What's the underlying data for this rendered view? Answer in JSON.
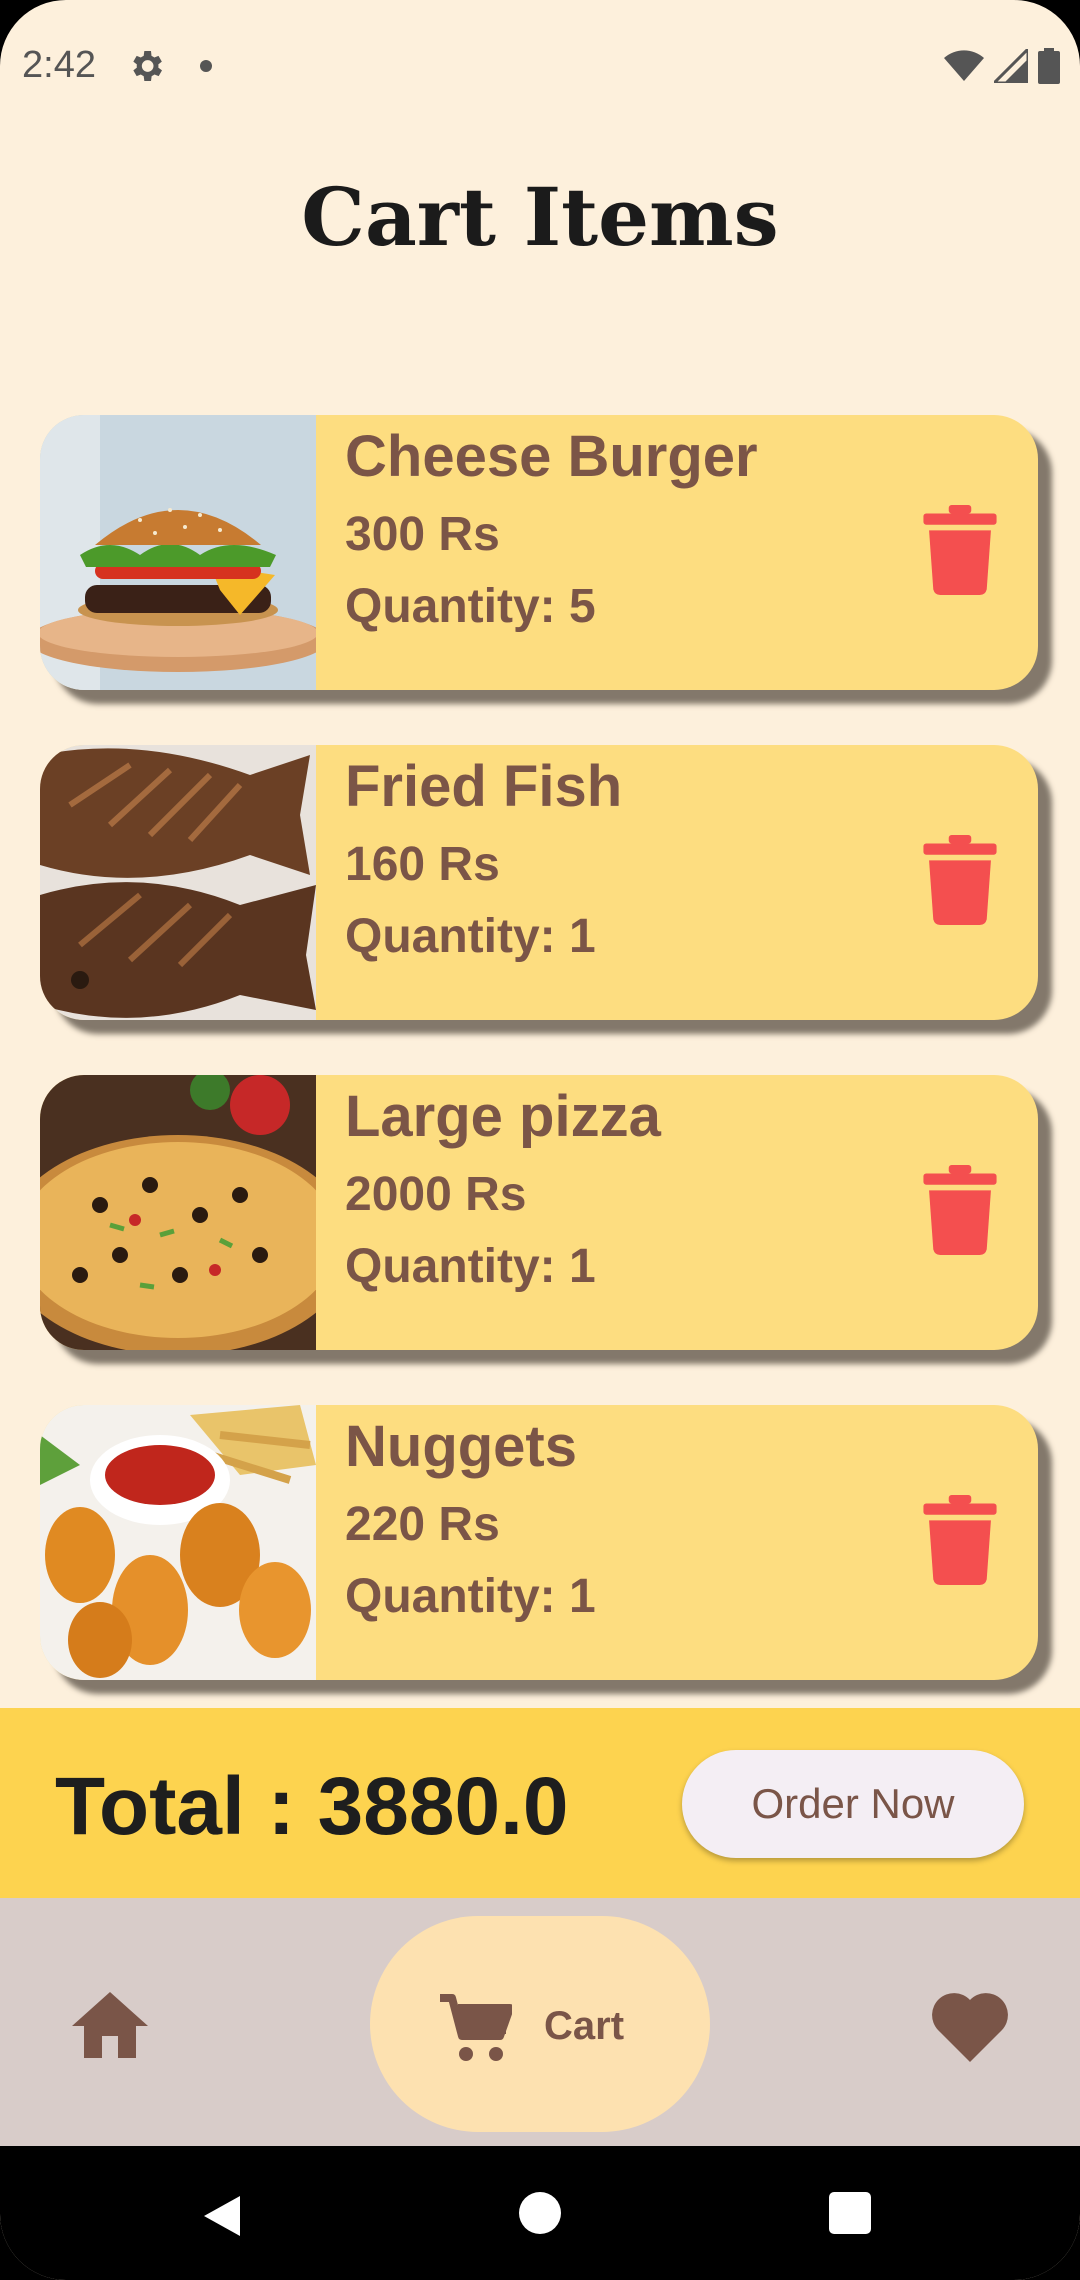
{
  "status_bar": {
    "time": "2:42"
  },
  "page": {
    "title": "Cart Items"
  },
  "cart": {
    "items": [
      {
        "name": "Cheese Burger",
        "price": "300 Rs",
        "quantity": "Quantity: 5",
        "image": "burger"
      },
      {
        "name": "Fried Fish",
        "price": "160 Rs",
        "quantity": "Quantity: 1",
        "image": "fried-fish"
      },
      {
        "name": "Large pizza",
        "price": "2000 Rs",
        "quantity": "Quantity: 1",
        "image": "pizza"
      },
      {
        "name": "Nuggets",
        "price": "220 Rs",
        "quantity": "Quantity: 1",
        "image": "nuggets"
      }
    ]
  },
  "total": {
    "label": "Total : 3880.0"
  },
  "order_button": {
    "label": "Order Now"
  },
  "bottom_nav": {
    "cart_label": "Cart"
  },
  "colors": {
    "background": "#fdf0dc",
    "card": "#fddd80",
    "text_brown": "#7b5547",
    "delete_red": "#f44f4f",
    "total_bar": "#fdd34f",
    "nav_bar": "#d8ccc9",
    "nav_active": "#fde1b0"
  }
}
